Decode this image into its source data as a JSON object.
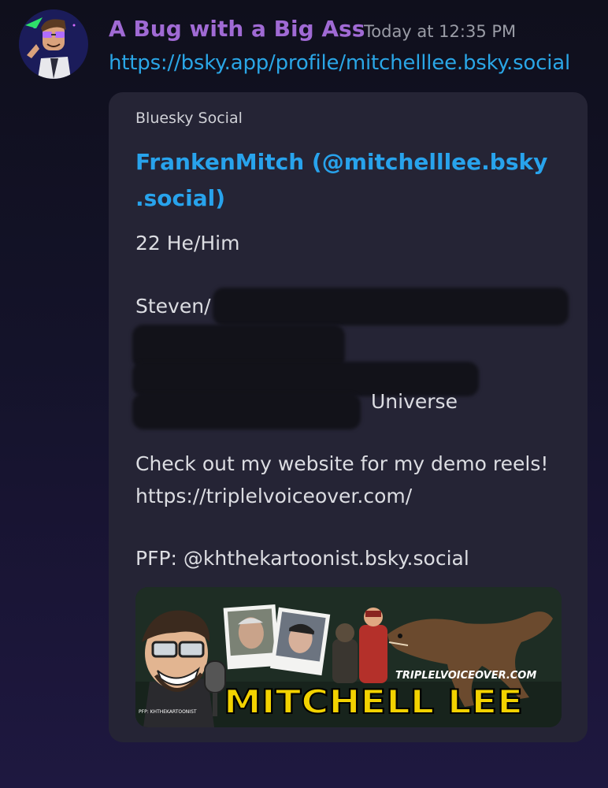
{
  "message": {
    "username": "A Bug with a Big Ass",
    "timestamp": "Today at 12:35 PM",
    "link": "https://bsky.app/profile/mitchelllee.bsky.social",
    "avatar_icon": "cartoon-avatar-icon"
  },
  "embed": {
    "provider": "Bluesky Social",
    "title_line1": "FrankenMitch  (@mitchelllee.bsky",
    "title_line2": ".social)",
    "lines": {
      "pronouns": "22 He/Him",
      "steven": "Steven/",
      "universe": "Universe",
      "check_out": "Check out my website for my demo reels!",
      "website": "https://triplelvoiceover.com/",
      "pfp": "PFP: @khthekartoonist.bsky.social"
    },
    "banner": {
      "site": "TRIPLELVOICEOVER.COM",
      "name": "MITCHELL LEE",
      "credit": "PFP: KHTHEKARTOONIST"
    }
  },
  "colors": {
    "username": "#a06ad4",
    "link": "#2aa6e6",
    "title": "#28a3ec",
    "card": "#252435",
    "banner_name": "#f2d200"
  }
}
